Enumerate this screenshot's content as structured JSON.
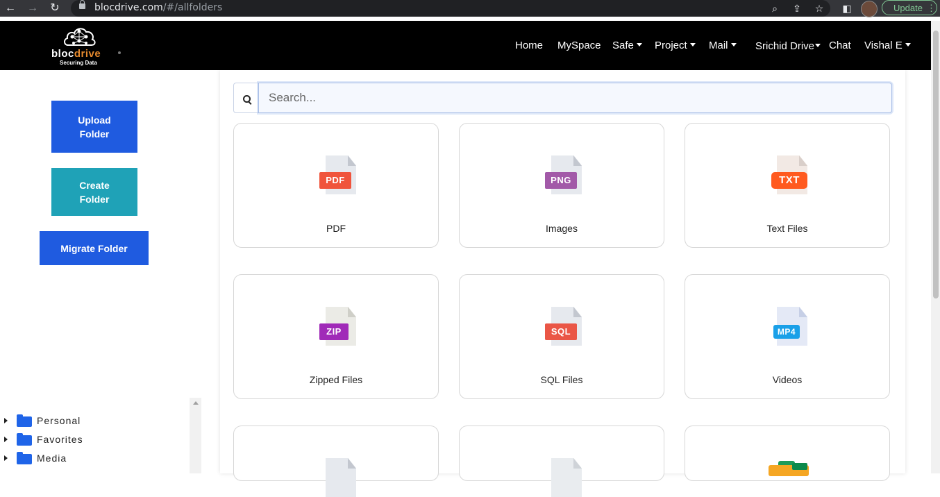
{
  "browser": {
    "url_host": "blocdrive.com",
    "url_path": "/#/allfolders",
    "update_label": "Update"
  },
  "brand": {
    "name_part1": "bloc",
    "name_part2": "drive",
    "tagline": "Securing Data"
  },
  "nav": {
    "items": [
      {
        "label": "Home",
        "dropdown": false
      },
      {
        "label": "MySpace",
        "dropdown": false
      },
      {
        "label": "Safe",
        "dropdown": true
      },
      {
        "label": "Project",
        "dropdown": true
      },
      {
        "label": "Mail",
        "dropdown": true
      },
      {
        "label": "Srichid Drive",
        "dropdown": true
      },
      {
        "label": "Chat",
        "dropdown": false
      },
      {
        "label": "Vishal E",
        "dropdown": true
      }
    ]
  },
  "sidebar": {
    "upload_label_line1": "Upload",
    "upload_label_line2": "Folder",
    "create_label_line1": "Create",
    "create_label_line2": "Folder",
    "migrate_label": "Migrate Folder",
    "tree": [
      {
        "label": "Personal"
      },
      {
        "label": "Favorites"
      },
      {
        "label": "Media"
      }
    ]
  },
  "search": {
    "placeholder": "Search..."
  },
  "categories": [
    {
      "label": "PDF",
      "badge": "PDF",
      "badge_color": "#f0543c"
    },
    {
      "label": "Images",
      "badge": "PNG",
      "badge_color": "#a259a8"
    },
    {
      "label": "Text Files",
      "badge": "TXT",
      "badge_color": "#ff5a1f"
    },
    {
      "label": "Zipped Files",
      "badge": "ZIP",
      "badge_color": "#a02ab8"
    },
    {
      "label": "SQL Files",
      "badge": "SQL",
      "badge_color": "#ea5646"
    },
    {
      "label": "Videos",
      "badge": "MP4",
      "badge_color": "#1aa0e8"
    }
  ],
  "colors": {
    "primary_button": "#1f5be0",
    "create_button": "#1fa2b7",
    "navbar_bg": "#000000"
  }
}
